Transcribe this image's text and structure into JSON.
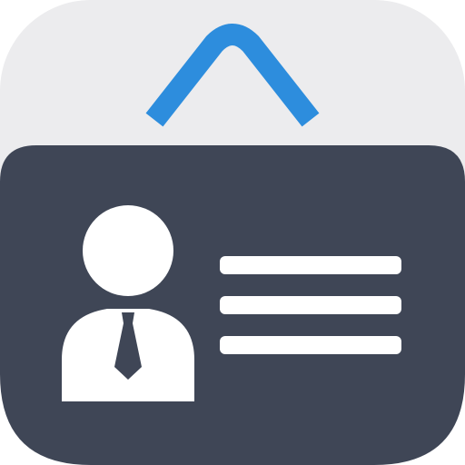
{
  "app_icon": {
    "icon": "id-badge-icon",
    "colors": {
      "tile": "#ececee",
      "card": "#3f4656",
      "lanyard": "#2d8ddd",
      "figure": "#ffffff",
      "tie": "#3f4656",
      "text_lines": "#ffffff"
    }
  }
}
